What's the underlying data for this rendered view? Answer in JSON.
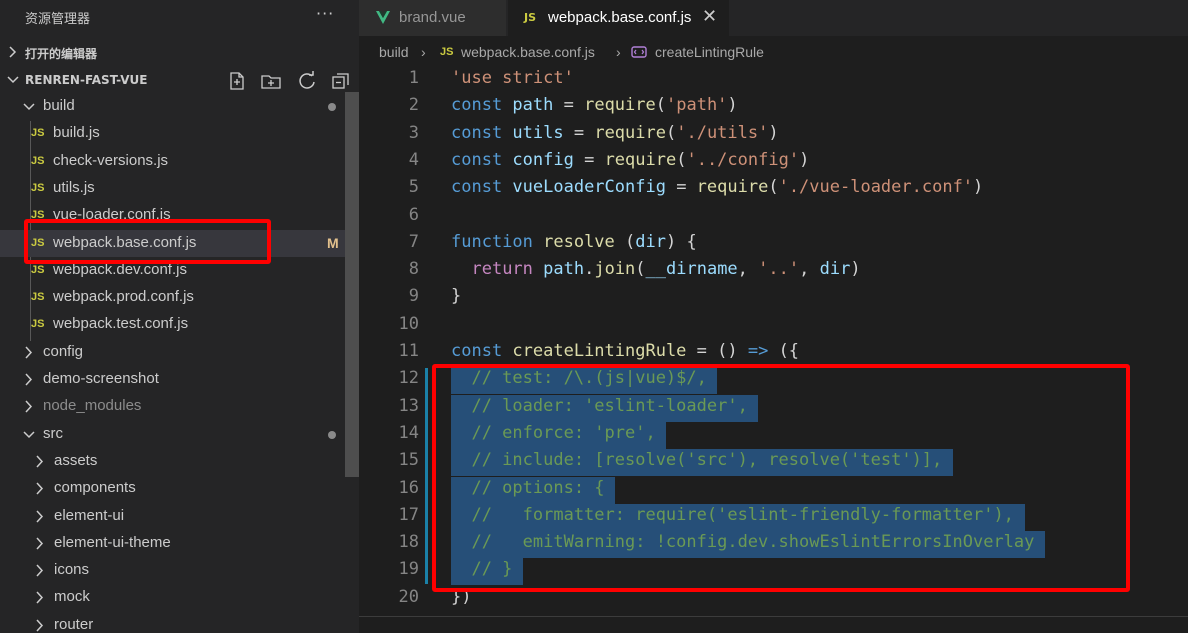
{
  "sidebar": {
    "title": "资源管理器",
    "more_label": "···",
    "open_editors_label": "打开的编辑器",
    "project_label": "RENREN-FAST-VUE",
    "project_actions": [
      "new-file-icon",
      "new-folder-icon",
      "refresh-icon",
      "collapse-all-icon"
    ],
    "tree": [
      {
        "name": "build",
        "kind": "folder",
        "expanded": true,
        "status": "dot"
      },
      {
        "name": "build.js",
        "kind": "js"
      },
      {
        "name": "check-versions.js",
        "kind": "js"
      },
      {
        "name": "utils.js",
        "kind": "js"
      },
      {
        "name": "vue-loader.conf.js",
        "kind": "js"
      },
      {
        "name": "webpack.base.conf.js",
        "kind": "js",
        "selected": true,
        "status": "M"
      },
      {
        "name": "webpack.dev.conf.js",
        "kind": "js"
      },
      {
        "name": "webpack.prod.conf.js",
        "kind": "js"
      },
      {
        "name": "webpack.test.conf.js",
        "kind": "js"
      },
      {
        "name": "config",
        "kind": "folder"
      },
      {
        "name": "demo-screenshot",
        "kind": "folder"
      },
      {
        "name": "node_modules",
        "kind": "folder",
        "faded": true
      },
      {
        "name": "src",
        "kind": "folder",
        "expanded": true,
        "status": "dot"
      },
      {
        "name": "assets",
        "kind": "folder"
      },
      {
        "name": "components",
        "kind": "folder"
      },
      {
        "name": "element-ui",
        "kind": "folder"
      },
      {
        "name": "element-ui-theme",
        "kind": "folder"
      },
      {
        "name": "icons",
        "kind": "folder"
      },
      {
        "name": "mock",
        "kind": "folder"
      },
      {
        "name": "router",
        "kind": "folder"
      }
    ]
  },
  "tabs": [
    {
      "label": "brand.vue",
      "icon": "vue-icon",
      "active": false
    },
    {
      "label": "webpack.base.conf.js",
      "icon": "js-icon",
      "active": true,
      "close": "✕"
    }
  ],
  "js_badge": "JS",
  "breadcrumb": {
    "segments": [
      "build",
      "webpack.base.conf.js",
      "createLintingRule"
    ],
    "separator": "›"
  },
  "editor": {
    "lines": [
      {
        "n": "1",
        "t": [
          [
            "str",
            "'use strict'"
          ]
        ]
      },
      {
        "n": "2",
        "t": [
          [
            "kw",
            "const "
          ],
          [
            "var",
            "path"
          ],
          [
            "pn",
            " = "
          ],
          [
            "fn",
            "require"
          ],
          [
            "pn",
            "("
          ],
          [
            "str",
            "'path'"
          ],
          [
            "pn",
            ")"
          ]
        ]
      },
      {
        "n": "3",
        "t": [
          [
            "kw",
            "const "
          ],
          [
            "var",
            "utils"
          ],
          [
            "pn",
            " = "
          ],
          [
            "fn",
            "require"
          ],
          [
            "pn",
            "("
          ],
          [
            "str",
            "'./utils'"
          ],
          [
            "pn",
            ")"
          ]
        ]
      },
      {
        "n": "4",
        "t": [
          [
            "kw",
            "const "
          ],
          [
            "var",
            "config"
          ],
          [
            "pn",
            " = "
          ],
          [
            "fn",
            "require"
          ],
          [
            "pn",
            "("
          ],
          [
            "str",
            "'../config'"
          ],
          [
            "pn",
            ")"
          ]
        ]
      },
      {
        "n": "5",
        "t": [
          [
            "kw",
            "const "
          ],
          [
            "var",
            "vueLoaderConfig"
          ],
          [
            "pn",
            " = "
          ],
          [
            "fn",
            "require"
          ],
          [
            "pn",
            "("
          ],
          [
            "str",
            "'./vue-loader.conf'"
          ],
          [
            "pn",
            ")"
          ]
        ]
      },
      {
        "n": "6",
        "t": []
      },
      {
        "n": "7",
        "t": [
          [
            "kw",
            "function "
          ],
          [
            "fn",
            "resolve"
          ],
          [
            "pn",
            " ("
          ],
          [
            "var",
            "dir"
          ],
          [
            "pn",
            ") {"
          ]
        ]
      },
      {
        "n": "8",
        "t": [
          [
            "pn",
            "  "
          ],
          [
            "kw2",
            "return "
          ],
          [
            "var",
            "path"
          ],
          [
            "pn",
            "."
          ],
          [
            "fn",
            "join"
          ],
          [
            "pn",
            "("
          ],
          [
            "var",
            "__dirname"
          ],
          [
            "pn",
            ", "
          ],
          [
            "str",
            "'..'"
          ],
          [
            "pn",
            ", "
          ],
          [
            "var",
            "dir"
          ],
          [
            "pn",
            ")"
          ]
        ]
      },
      {
        "n": "9",
        "t": [
          [
            "pn",
            "}"
          ]
        ]
      },
      {
        "n": "10",
        "t": []
      },
      {
        "n": "11",
        "t": [
          [
            "kw",
            "const "
          ],
          [
            "fn",
            "createLintingRule"
          ],
          [
            "pn",
            " = () "
          ],
          [
            "kw",
            "=>"
          ],
          [
            "pn",
            " ({"
          ]
        ]
      },
      {
        "n": "12",
        "t": [
          [
            "cm",
            "  // test: /\\.(js|vue)$/,"
          ]
        ],
        "sel": true
      },
      {
        "n": "13",
        "t": [
          [
            "cm",
            "  // loader: 'eslint-loader',"
          ]
        ],
        "sel": true
      },
      {
        "n": "14",
        "t": [
          [
            "cm",
            "  // enforce: 'pre',"
          ]
        ],
        "sel": true
      },
      {
        "n": "15",
        "t": [
          [
            "cm",
            "  // include: [resolve('src'), resolve('test')],"
          ]
        ],
        "sel": true
      },
      {
        "n": "16",
        "t": [
          [
            "cm",
            "  // options: {"
          ]
        ],
        "sel": true
      },
      {
        "n": "17",
        "t": [
          [
            "cm",
            "  //   formatter: require('eslint-friendly-formatter'),"
          ]
        ],
        "sel": true
      },
      {
        "n": "18",
        "t": [
          [
            "cm",
            "  //   emitWarning: !config.dev.showEslintErrorsInOverlay"
          ]
        ],
        "sel": true
      },
      {
        "n": "19",
        "t": [
          [
            "cm",
            "  // }"
          ]
        ],
        "sel": true
      },
      {
        "n": "20",
        "t": [
          [
            "pn",
            "})"
          ]
        ]
      }
    ]
  },
  "colors": {
    "highlight_box": "#ff0000",
    "selection": "#264f78",
    "js_badge": "#cbcb41",
    "vue_green": "#41b883",
    "modified": "#e2c08d"
  }
}
